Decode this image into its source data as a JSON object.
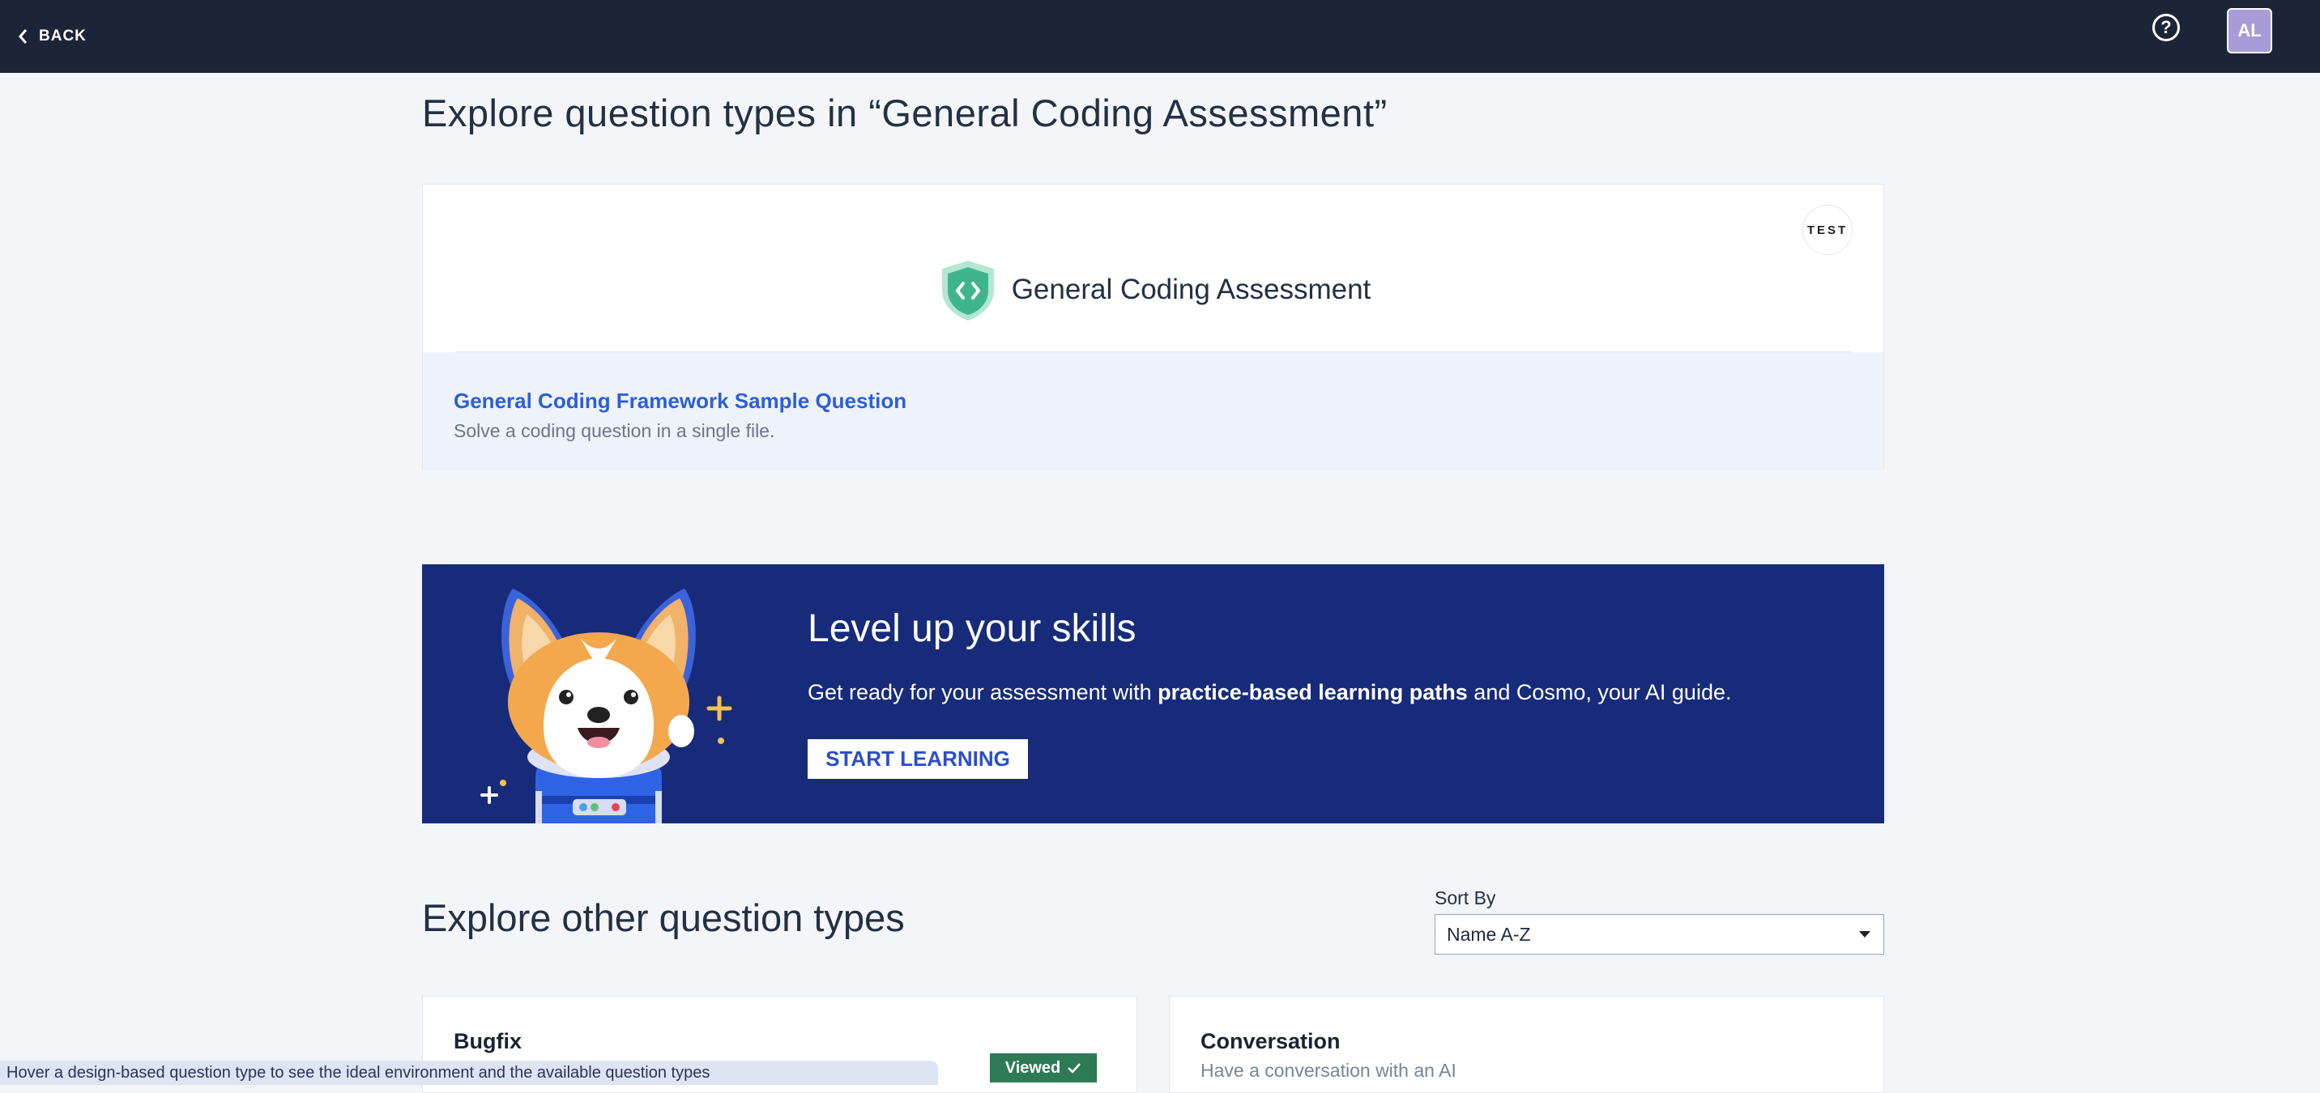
{
  "header": {
    "back_label": "BACK",
    "help_glyph": "?",
    "avatar_initials": "AL",
    "background": "#1c2537"
  },
  "page": {
    "title": "Explore question types in “General Coding Assessment”"
  },
  "assessment": {
    "badge": "TEST",
    "name": "General Coding Assessment",
    "sample": {
      "title": "General Coding Framework Sample Question",
      "description": "Solve a coding question in a single file."
    }
  },
  "banner": {
    "title": "Level up your skills",
    "text_before": "Get ready for your assessment with ",
    "text_bold": "practice-based learning paths",
    "text_after": " and Cosmo, your AI guide.",
    "button_label": "START LEARNING",
    "background": "#172b7a"
  },
  "other": {
    "title": "Explore other question types",
    "sort_label": "Sort By",
    "sort_value": "Name A-Z",
    "cards": [
      {
        "title": "Bugfix",
        "description": "",
        "badge": "Viewed"
      },
      {
        "title": "Conversation",
        "description": "Have a conversation with an AI"
      }
    ]
  },
  "tooltip": {
    "text": "Hover a design-based question type to see the ideal environment and the available question types"
  },
  "icons": {
    "back": "chevron-left-icon",
    "help": "help-circle-icon",
    "shield": "code-shield-icon",
    "check": "check-icon",
    "mascot": "corgi-mascot-icon"
  },
  "colors": {
    "accent": "#2b5fd9",
    "viewed": "#2e7a55",
    "shield": "#3fb58e"
  }
}
